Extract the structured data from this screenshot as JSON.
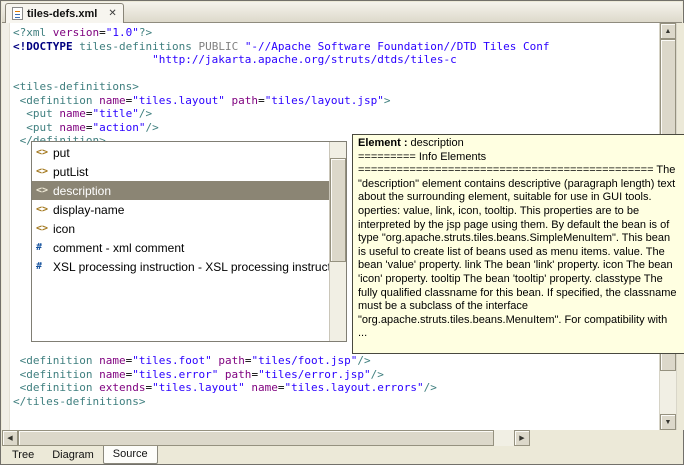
{
  "colors": {
    "tag": "#3f7f7f",
    "attr": "#7f007f",
    "value": "#2a00ff",
    "doctype": "#000080",
    "keyword": "#808080",
    "selection_bg": "#8b8574",
    "tooltip_bg": "#ffffe1"
  },
  "editor_tab": {
    "title": "tiles-defs.xml",
    "close": "✕"
  },
  "editor": {
    "top_lines": [
      [
        [
          "t",
          "<?xml "
        ],
        [
          "a",
          "version"
        ],
        [
          "p",
          "="
        ],
        [
          "v",
          "\"1.0\""
        ],
        [
          "t",
          "?>"
        ]
      ],
      [
        [
          "d",
          "<!DOCTYPE "
        ],
        [
          "t",
          "tiles-definitions "
        ],
        [
          "k",
          "PUBLIC "
        ],
        [
          "v",
          "\"-//Apache Software Foundation//DTD Tiles Conf"
        ]
      ],
      [
        [
          "p",
          "                     "
        ],
        [
          "v",
          "\"http://jakarta.apache.org/struts/dtds/tiles-c"
        ]
      ],
      [],
      [
        [
          "t",
          "<tiles-definitions>"
        ]
      ],
      [
        [
          "t",
          " <definition "
        ],
        [
          "a",
          "name"
        ],
        [
          "p",
          "="
        ],
        [
          "v",
          "\"tiles.layout\""
        ],
        [
          "a",
          " path"
        ],
        [
          "p",
          "="
        ],
        [
          "v",
          "\"tiles/layout.jsp\""
        ],
        [
          "t",
          ">"
        ]
      ],
      [
        [
          "t",
          "  <put "
        ],
        [
          "a",
          "name"
        ],
        [
          "p",
          "="
        ],
        [
          "v",
          "\"title\""
        ],
        [
          "t",
          "/>"
        ]
      ],
      [
        [
          "t",
          "  <put "
        ],
        [
          "a",
          "name"
        ],
        [
          "p",
          "="
        ],
        [
          "v",
          "\"action\""
        ],
        [
          "t",
          "/>"
        ]
      ],
      [
        [
          "t",
          " </definition>"
        ]
      ]
    ],
    "bottom_lines": [
      [
        [
          "t",
          " <definition "
        ],
        [
          "a",
          "name"
        ],
        [
          "p",
          "="
        ],
        [
          "v",
          "\"tiles.foot\""
        ],
        [
          "a",
          " path"
        ],
        [
          "p",
          "="
        ],
        [
          "v",
          "\"tiles/foot.jsp\""
        ],
        [
          "t",
          "/>"
        ]
      ],
      [
        [
          "t",
          " <definition "
        ],
        [
          "a",
          "name"
        ],
        [
          "p",
          "="
        ],
        [
          "v",
          "\"tiles.error\""
        ],
        [
          "a",
          " path"
        ],
        [
          "p",
          "="
        ],
        [
          "v",
          "\"tiles/error.jsp\""
        ],
        [
          "t",
          "/>"
        ]
      ],
      [
        [
          "t",
          " <definition "
        ],
        [
          "a",
          "extends"
        ],
        [
          "p",
          "="
        ],
        [
          "v",
          "\"tiles.layout\""
        ],
        [
          "a",
          " name"
        ],
        [
          "p",
          "="
        ],
        [
          "v",
          "\"tiles.layout.errors\""
        ],
        [
          "t",
          "/>"
        ]
      ],
      [
        [
          "t",
          "</tiles-definitions>"
        ]
      ]
    ]
  },
  "popup": {
    "items": [
      {
        "icon": "<>",
        "label": "put",
        "selected": false
      },
      {
        "icon": "<>",
        "label": "putList",
        "selected": false
      },
      {
        "icon": "<>",
        "label": "description",
        "selected": true
      },
      {
        "icon": "<>",
        "label": "display-name",
        "selected": false
      },
      {
        "icon": "<>",
        "label": "icon",
        "selected": false
      },
      {
        "icon": "#",
        "label": "comment - xml comment",
        "selected": false
      },
      {
        "icon": "#",
        "label": "XSL processing instruction - XSL processing instruction",
        "selected": false
      }
    ]
  },
  "tooltip": {
    "title_label": "Element :",
    "title_value": "description",
    "info_line": "========= Info Elements",
    "body": "============================================== The \"description\" element contains descriptive (paragraph length) text about the surrounding element, suitable for use in GUI tools. operties: value, link, icon, tooltip. This properties are to be interpreted by the jsp page using them. By default the bean is of type \"org.apache.struts.tiles.beans.SimpleMenuItem\". This bean is useful to create list of beans used as menu items. value. The bean 'value' property. link The bean 'link' property. icon The bean 'icon' property. tooltip The bean 'tooltip' property. classtype The fully qualified classname for this bean. If specified, the classname must be a subclass of the interface \"org.apache.struts.tiles.beans.MenuItem\". For compatibility with",
    "truncation": "..."
  },
  "bottom_tabs": {
    "items": [
      {
        "label": "Tree",
        "active": false
      },
      {
        "label": "Diagram",
        "active": false
      },
      {
        "label": "Source",
        "active": true
      }
    ]
  }
}
